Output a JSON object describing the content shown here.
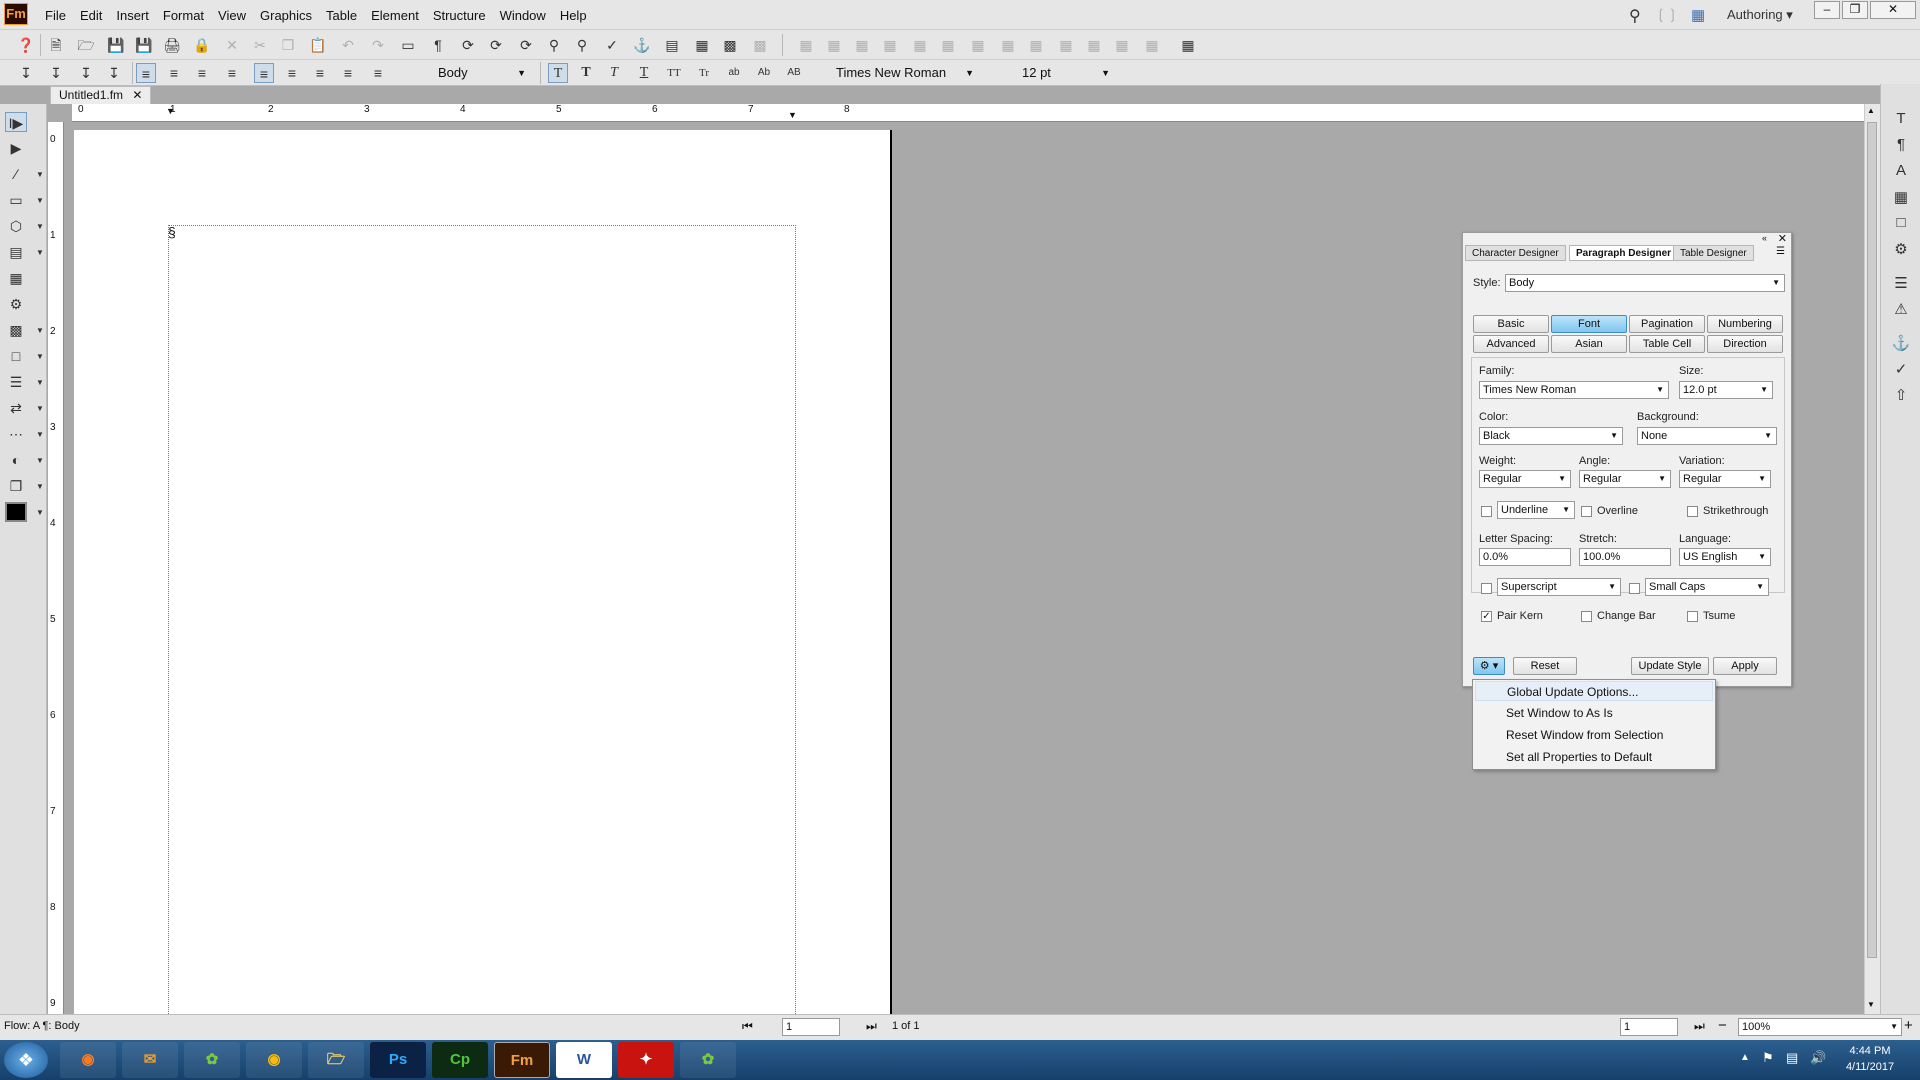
{
  "app": {
    "logo": "Fm",
    "document_tab": "Untitled1.fm"
  },
  "menu": [
    "File",
    "Edit",
    "Insert",
    "Format",
    "View",
    "Graphics",
    "Table",
    "Element",
    "Structure",
    "Window",
    "Help"
  ],
  "workspace": "Authoring",
  "toolbar2": {
    "paragraph_style": "Body",
    "font_family": "Times New Roman",
    "font_size": "12 pt",
    "text_buttons": [
      "T",
      "T",
      "T",
      "T",
      "TT",
      "Tr",
      "ab",
      "Ab",
      "AB"
    ]
  },
  "ruler": {
    "top_ticks": [
      "0",
      "1",
      "2",
      "3",
      "4",
      "5",
      "6",
      "7",
      "8"
    ],
    "left_ticks": [
      "0",
      "1",
      "2",
      "3",
      "4",
      "5",
      "6",
      "7",
      "8",
      "9"
    ]
  },
  "status": {
    "flow": "Flow: A  ¶: Body",
    "page_input": "1",
    "page_count": "1 of 1",
    "page_right_input": "1",
    "zoom": "100%"
  },
  "designer": {
    "tabs": [
      "Character Designer",
      "Paragraph Designer",
      "Table Designer"
    ],
    "style_label": "Style:",
    "style_value": "Body",
    "buttons_row1": [
      "Basic",
      "Font",
      "Pagination",
      "Numbering"
    ],
    "buttons_row2": [
      "Advanced",
      "Asian",
      "Table Cell",
      "Direction"
    ],
    "family_label": "Family:",
    "family_value": "Times New Roman",
    "size_label": "Size:",
    "size_value": "12.0 pt",
    "color_label": "Color:",
    "color_value": "Black",
    "background_label": "Background:",
    "background_value": "None",
    "weight_label": "Weight:",
    "weight_value": "Regular",
    "angle_label": "Angle:",
    "angle_value": "Regular",
    "variation_label": "Variation:",
    "variation_value": "Regular",
    "underline_value": "Underline",
    "overline_label": "Overline",
    "strikethrough_label": "Strikethrough",
    "letter_spacing_label": "Letter Spacing:",
    "letter_spacing_value": "0.0%",
    "stretch_label": "Stretch:",
    "stretch_value": "100.0%",
    "language_label": "Language:",
    "language_value": "US English",
    "superscript_value": "Superscript",
    "smallcaps_value": "Small Caps",
    "pairkern_label": "Pair Kern",
    "changebar_label": "Change Bar",
    "tsume_label": "Tsume",
    "reset_label": "Reset",
    "update_style_label": "Update Style",
    "apply_label": "Apply"
  },
  "context_menu": [
    "Global Update Options...",
    "Set Window to As Is",
    "Reset Window from Selection",
    "Set all Properties to Default"
  ],
  "clock": {
    "time": "4:44 PM",
    "date": "4/11/2017"
  },
  "taskbar_apps": [
    "Ps",
    "Cp",
    "Fm",
    "W"
  ]
}
